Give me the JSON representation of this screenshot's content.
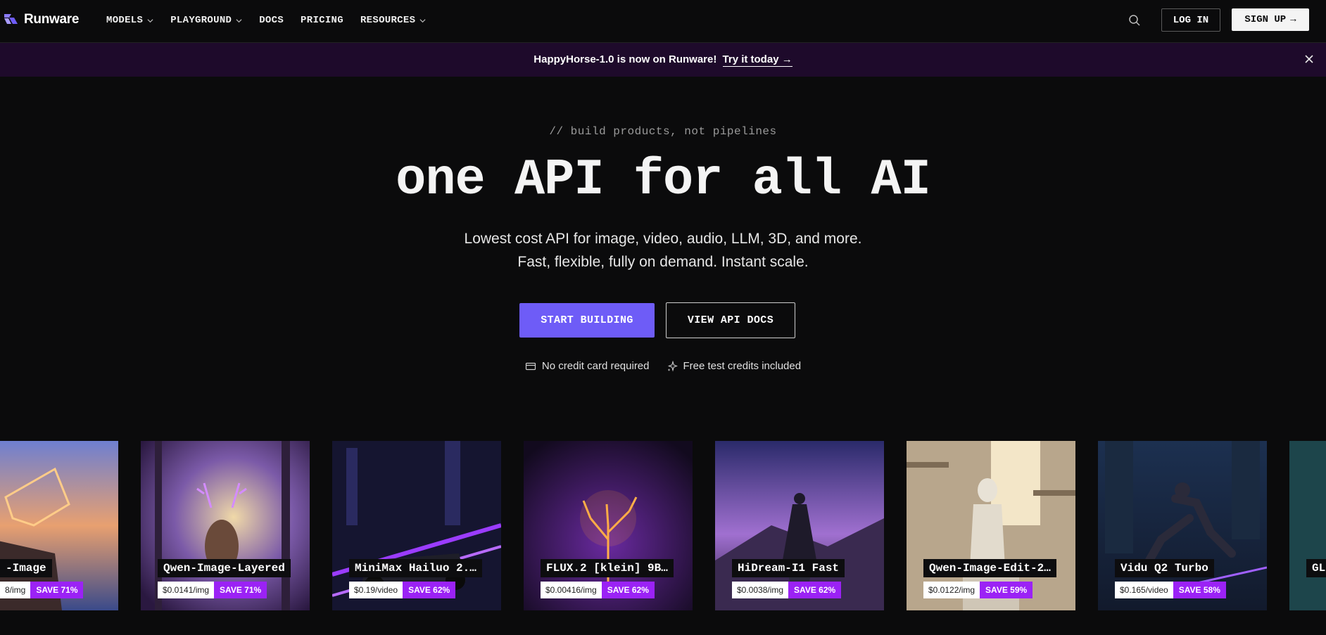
{
  "brand": {
    "name": "Runware",
    "accent": "#6e5cf7",
    "save_color": "#9b22f5"
  },
  "nav": {
    "items": [
      {
        "label": "MODELS",
        "has_dropdown": true
      },
      {
        "label": "PLAYGROUND",
        "has_dropdown": true
      },
      {
        "label": "DOCS",
        "has_dropdown": false
      },
      {
        "label": "PRICING",
        "has_dropdown": false
      },
      {
        "label": "RESOURCES",
        "has_dropdown": true
      }
    ],
    "search_icon": "search-icon",
    "login_label": "LOG IN",
    "signup_label": "SIGN UP",
    "signup_arrow": "→"
  },
  "banner": {
    "text": "HappyHorse-1.0 is now on Runware!",
    "link": "Try it today →",
    "close_icon": "close-icon"
  },
  "hero": {
    "tagline": "// build products, not pipelines",
    "headline": "one API for all AI",
    "sub1": "Lowest cost API for image, video, audio, LLM, 3D, and more.",
    "sub2": "Fast, flexible, fully on demand. Instant scale.",
    "primary_cta": "START BUILDING",
    "secondary_cta": "VIEW API DOCS",
    "perks": [
      {
        "icon": "credit-card-icon",
        "label": "No credit card required"
      },
      {
        "icon": "sparkles-icon",
        "label": "Free test credits included"
      }
    ]
  },
  "cards": [
    {
      "title": "-Image",
      "price": "8/img",
      "save": "SAVE 71%"
    },
    {
      "title": "Qwen-Image-Layered",
      "price": "$0.0141/img",
      "save": "SAVE 71%"
    },
    {
      "title": "MiniMax Hailuo 2.…",
      "price": "$0.19/video",
      "save": "SAVE 62%"
    },
    {
      "title": "FLUX.2 [klein] 9B…",
      "price": "$0.00416/img",
      "save": "SAVE 62%"
    },
    {
      "title": "HiDream-I1 Fast",
      "price": "$0.0038/img",
      "save": "SAVE 62%"
    },
    {
      "title": "Qwen-Image-Edit-2…",
      "price": "$0.0122/img",
      "save": "SAVE 59%"
    },
    {
      "title": "Vidu Q2 Turbo",
      "price": "$0.165/video",
      "save": "SAVE 58%"
    },
    {
      "title": "GL",
      "price": "",
      "save": ""
    }
  ]
}
